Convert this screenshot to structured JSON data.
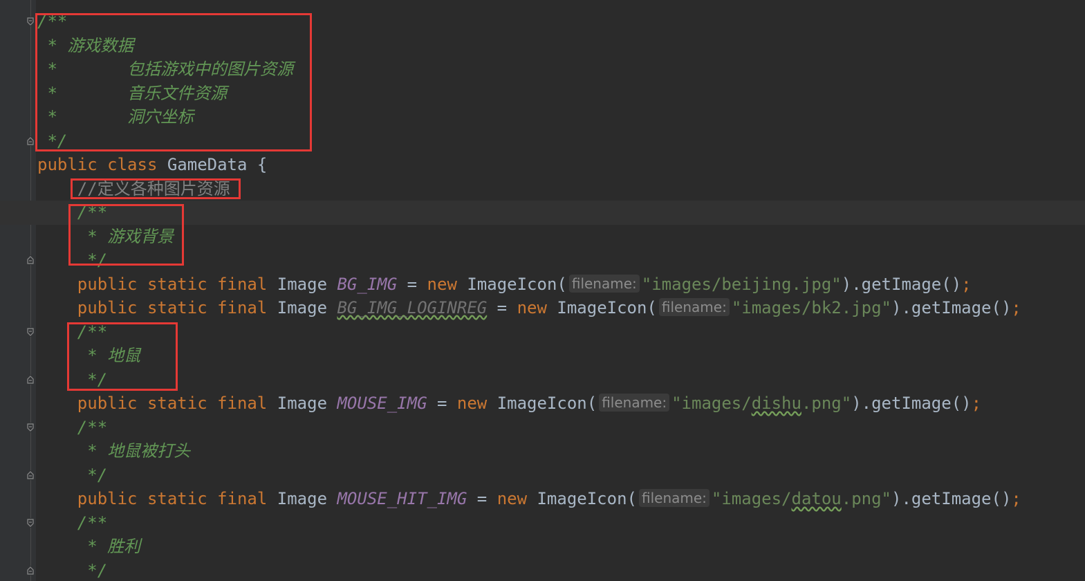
{
  "editor": {
    "lines": [
      [
        {
          "t": "/**",
          "c": "doc"
        }
      ],
      [
        {
          "t": " * 游戏数据",
          "c": "doc"
        }
      ],
      [
        {
          "t": " *       包括游戏中的图片资源",
          "c": "doc"
        }
      ],
      [
        {
          "t": " *       音乐文件资源",
          "c": "doc"
        }
      ],
      [
        {
          "t": " *       洞穴坐标",
          "c": "doc"
        }
      ],
      [
        {
          "t": " */",
          "c": "doc"
        }
      ],
      [
        {
          "t": "public class ",
          "c": "kw"
        },
        {
          "t": "GameData {",
          "c": ""
        }
      ],
      [
        {
          "t": "    ",
          "c": ""
        },
        {
          "t": "//定义各种图片资源",
          "c": "cm"
        }
      ],
      [
        {
          "t": "    ",
          "c": ""
        },
        {
          "t": "/**",
          "c": "doc"
        }
      ],
      [
        {
          "t": "    ",
          "c": ""
        },
        {
          "t": " * 游戏背景",
          "c": "doc"
        }
      ],
      [
        {
          "t": "    ",
          "c": ""
        },
        {
          "t": " */",
          "c": "doc"
        }
      ],
      [
        {
          "t": "    ",
          "c": ""
        },
        {
          "t": "public static final ",
          "c": "kw"
        },
        {
          "t": "Image ",
          "c": ""
        },
        {
          "t": "BG_IMG",
          "c": "fld"
        },
        {
          "t": " = ",
          "c": ""
        },
        {
          "t": "new ",
          "c": "kw"
        },
        {
          "t": "ImageIcon(",
          "c": ""
        },
        {
          "t": "filename:",
          "c": "hint"
        },
        {
          "t": "\"images/beijing.jpg\"",
          "c": "str"
        },
        {
          "t": ").getImage()",
          "c": ""
        },
        {
          "t": ";",
          "c": "kw"
        }
      ],
      [
        {
          "t": "    ",
          "c": ""
        },
        {
          "t": "public static final ",
          "c": "kw"
        },
        {
          "t": "Image ",
          "c": ""
        },
        {
          "t": "BG_IMG_LOGINREG",
          "c": "fld-unused"
        },
        {
          "t": " = ",
          "c": ""
        },
        {
          "t": "new ",
          "c": "kw"
        },
        {
          "t": "ImageIcon(",
          "c": ""
        },
        {
          "t": "filename:",
          "c": "hint"
        },
        {
          "t": "\"images/bk2.jpg\"",
          "c": "str"
        },
        {
          "t": ").getImage()",
          "c": ""
        },
        {
          "t": ";",
          "c": "kw"
        }
      ],
      [
        {
          "t": "    ",
          "c": ""
        },
        {
          "t": "/**",
          "c": "doc"
        }
      ],
      [
        {
          "t": "    ",
          "c": ""
        },
        {
          "t": " * 地鼠",
          "c": "doc"
        }
      ],
      [
        {
          "t": "    ",
          "c": ""
        },
        {
          "t": " */",
          "c": "doc"
        }
      ],
      [
        {
          "t": "    ",
          "c": ""
        },
        {
          "t": "public static final ",
          "c": "kw"
        },
        {
          "t": "Image ",
          "c": ""
        },
        {
          "t": "MOUSE_IMG",
          "c": "fld"
        },
        {
          "t": " = ",
          "c": ""
        },
        {
          "t": "new ",
          "c": "kw"
        },
        {
          "t": "ImageIcon(",
          "c": ""
        },
        {
          "t": "filename:",
          "c": "hint"
        },
        {
          "t": "\"images/",
          "c": "str"
        },
        {
          "t": "dishu",
          "c": "str typo"
        },
        {
          "t": ".png\"",
          "c": "str"
        },
        {
          "t": ").getImage()",
          "c": ""
        },
        {
          "t": ";",
          "c": "kw"
        }
      ],
      [
        {
          "t": "    ",
          "c": ""
        },
        {
          "t": "/**",
          "c": "doc"
        }
      ],
      [
        {
          "t": "    ",
          "c": ""
        },
        {
          "t": " * 地鼠被打头",
          "c": "doc"
        }
      ],
      [
        {
          "t": "    ",
          "c": ""
        },
        {
          "t": " */",
          "c": "doc"
        }
      ],
      [
        {
          "t": "    ",
          "c": ""
        },
        {
          "t": "public static final ",
          "c": "kw"
        },
        {
          "t": "Image ",
          "c": ""
        },
        {
          "t": "MOUSE_HIT_IMG",
          "c": "fld"
        },
        {
          "t": " = ",
          "c": ""
        },
        {
          "t": "new ",
          "c": "kw"
        },
        {
          "t": "ImageIcon(",
          "c": ""
        },
        {
          "t": "filename:",
          "c": "hint"
        },
        {
          "t": "\"images/",
          "c": "str"
        },
        {
          "t": "datou",
          "c": "str typo"
        },
        {
          "t": ".png\"",
          "c": "str"
        },
        {
          "t": ").getImage()",
          "c": ""
        },
        {
          "t": ";",
          "c": "kw"
        }
      ],
      [
        {
          "t": "    ",
          "c": ""
        },
        {
          "t": "/**",
          "c": "doc"
        }
      ],
      [
        {
          "t": "    ",
          "c": ""
        },
        {
          "t": " * 胜利",
          "c": "doc"
        }
      ],
      [
        {
          "t": "    ",
          "c": ""
        },
        {
          "t": " */",
          "c": "doc"
        }
      ]
    ],
    "current_line": 8,
    "fold_markers": [
      0,
      5,
      8,
      10,
      13,
      15,
      17,
      19,
      21,
      23
    ]
  },
  "colors": {
    "background": "#2b2b2b",
    "keyword": "#cc7832",
    "doc_comment": "#629755",
    "line_comment": "#808080",
    "string": "#6a8759",
    "static_field": "#9876aa",
    "highlight_box": "#e53935",
    "bulb": "#f0b429"
  },
  "icons": {
    "intention_bulb": "lightbulb-icon",
    "fold_open": "fold-open-icon",
    "fold_close": "fold-close-icon"
  }
}
